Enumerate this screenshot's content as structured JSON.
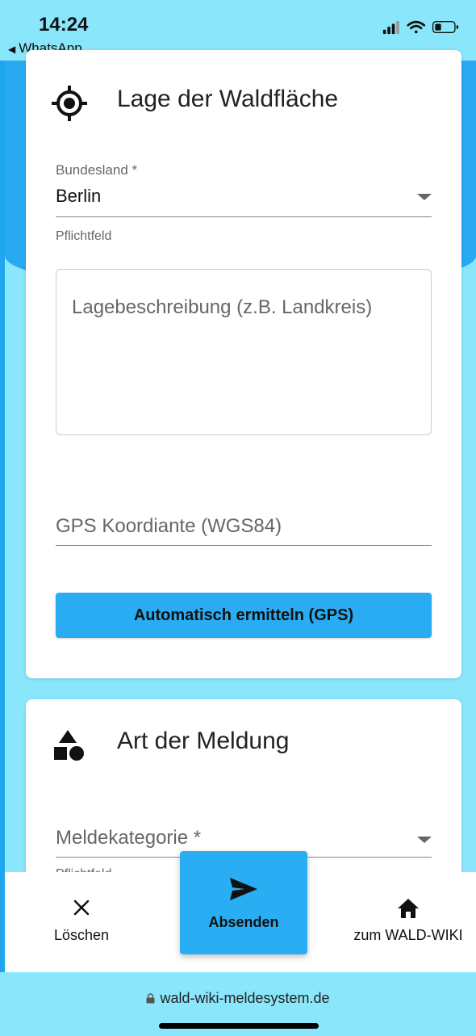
{
  "status_bar": {
    "time": "14:24",
    "back_app": "WhatsApp",
    "back_icon": "back-triangle-icon",
    "icons": [
      "signal-icon",
      "wifi-icon",
      "battery-icon"
    ]
  },
  "section_location": {
    "title": "Lage der Waldfläche",
    "icon": "crosshair-icon",
    "state_field": {
      "label": "Bundesland *",
      "value": "Berlin",
      "helper": "Pflichtfeld"
    },
    "description_placeholder": "Lagebeschreibung (z.B. Landkreis)",
    "gps_placeholder": "GPS Koordiante (WGS84)",
    "gps_button": "Automatisch ermitteln (GPS)"
  },
  "section_report_type": {
    "title": "Art der Meldung",
    "icon": "shapes-icon",
    "category_placeholder": "Meldekategorie *",
    "helper": "Pflichtfeld"
  },
  "bottom_bar": {
    "delete_label": "Löschen",
    "submit_label": "Absenden",
    "wiki_label": "zum WALD-WIKI"
  },
  "browser": {
    "url": "wald-wiki-meldesystem.de"
  },
  "colors": {
    "accent": "#29acf1",
    "background": "#8ae6fb"
  }
}
